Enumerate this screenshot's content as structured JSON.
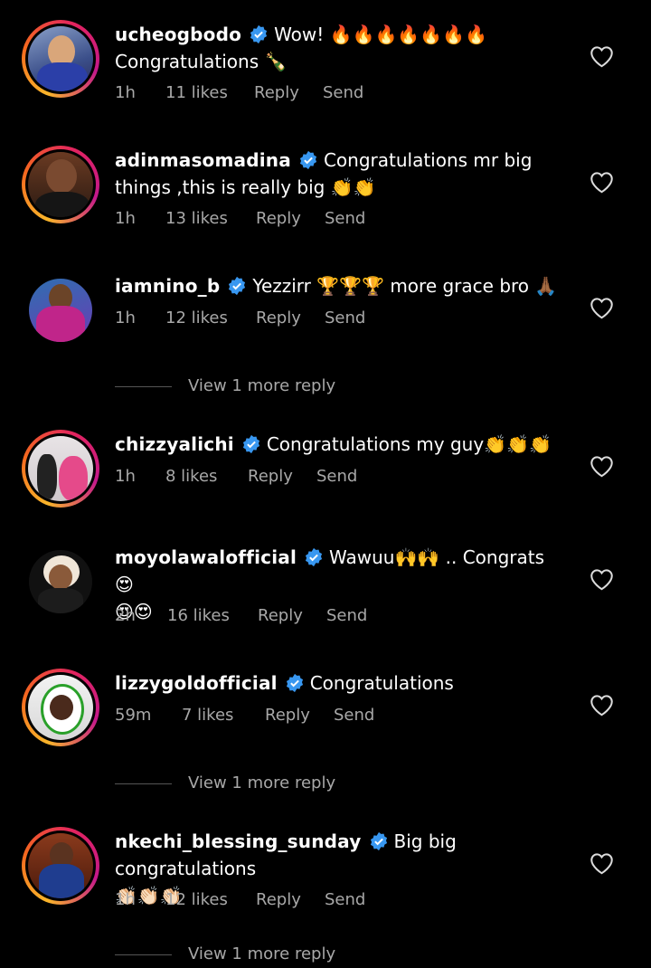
{
  "comments": [
    {
      "username": "ucheogbodo",
      "text": "Wow! 🔥🔥🔥🔥🔥🔥🔥",
      "text2": "Congratulations 🍾",
      "time": "1h",
      "likes": "11 likes",
      "reply": "Reply",
      "send": "Send"
    },
    {
      "username": "adinmasomadina",
      "text": "Congratulations mr big",
      "text2": "things ,this is really big 👏👏",
      "time": "1h",
      "likes": "13 likes",
      "reply": "Reply",
      "send": "Send"
    },
    {
      "username": "iamnino_b",
      "text": "Yezzirr 🏆🏆🏆 more grace bro 🙏🏾",
      "time": "1h",
      "likes": "12 likes",
      "reply": "Reply",
      "send": "Send"
    },
    {
      "username": "chizzyalichi",
      "text": "Congratulations my guy👏👏👏",
      "time": "1h",
      "likes": "8 likes",
      "reply": "Reply",
      "send": "Send"
    },
    {
      "username": "moyolawalofficial",
      "text": "Wawuu🙌🙌 .. Congrats 😍",
      "text2": "😍😍",
      "time": "2h",
      "likes": "16 likes",
      "reply": "Reply",
      "send": "Send"
    },
    {
      "username": "lizzygoldofficial",
      "text": "Congratulations",
      "time": "59m",
      "likes": "7 likes",
      "reply": "Reply",
      "send": "Send"
    },
    {
      "username": "nkechi_blessing_sunday",
      "text": "Big big congratulations",
      "text2": "👏🏻👏🏻👏🏻",
      "time": "1h",
      "likes": "12 likes",
      "reply": "Reply",
      "send": "Send"
    }
  ],
  "view_more": [
    "View 1 more reply",
    "View 1 more reply",
    "View 1 more reply"
  ]
}
